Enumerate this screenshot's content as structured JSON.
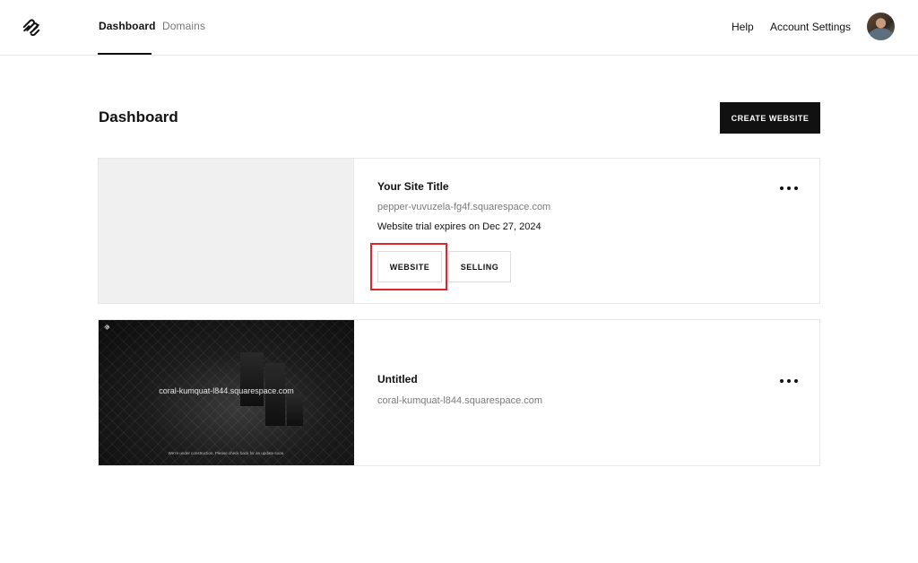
{
  "nav": {
    "tabs": [
      {
        "label": "Dashboard",
        "active": true
      },
      {
        "label": "Domains",
        "active": false
      }
    ],
    "help_label": "Help",
    "account_label": "Account Settings"
  },
  "page": {
    "title": "Dashboard",
    "create_label": "CREATE WEBSITE"
  },
  "sites": [
    {
      "title": "Your Site Title",
      "url": "pepper-vuvuzela-fg4f.squarespace.com",
      "trial": "Website trial expires on Dec 27, 2024",
      "buttons": {
        "website": "WEBSITE",
        "selling": "SELLING"
      }
    },
    {
      "title": "Untitled",
      "url": "coral-kumquat-l844.squarespace.com",
      "thumbnail": {
        "domain": "coral-kumquat-l844.squarespace.com",
        "note": "We're under construction. Please check back for an update soon."
      }
    }
  ],
  "icons": {
    "logo": "squarespace-logo-icon",
    "more": "more-horizontal-icon",
    "avatar": "user-avatar"
  },
  "colors": {
    "primary": "#111111",
    "highlight": "#e0262d",
    "muted_text": "#7a7a7a",
    "thumb_placeholder": "#f0f0f0"
  }
}
